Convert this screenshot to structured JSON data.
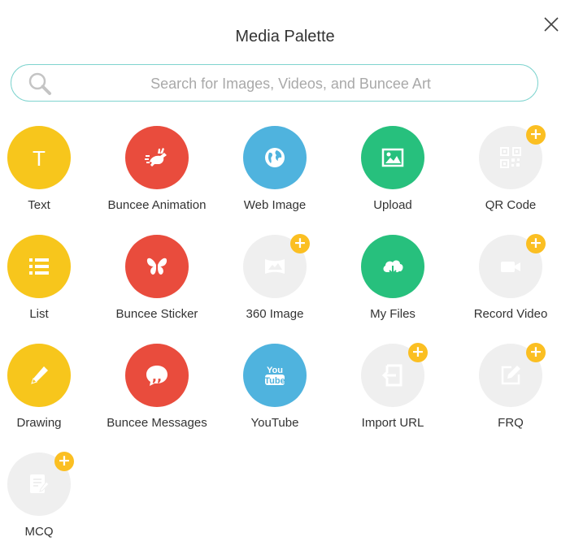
{
  "dialog": {
    "title": "Media Palette",
    "search_placeholder": "Search for Images, Videos, and Buncee Art"
  },
  "colors": {
    "yellow": "#f7c61c",
    "red": "#e94c3d",
    "blue": "#4fb3de",
    "green": "#27c07d",
    "disabled": "#efefef",
    "premium_badge": "#fbbf22",
    "search_border": "#7fd4cf"
  },
  "items": [
    {
      "label": "Text",
      "icon": "text-t-icon",
      "color": "yellow",
      "premium": false
    },
    {
      "label": "Buncee Animation",
      "icon": "running-rabbit-icon",
      "color": "red",
      "premium": false
    },
    {
      "label": "Web Image",
      "icon": "globe-icon",
      "color": "blue",
      "premium": false
    },
    {
      "label": "Upload",
      "icon": "image-upload-icon",
      "color": "green",
      "premium": false
    },
    {
      "label": "QR Code",
      "icon": "qr-code-icon",
      "color": "disabled",
      "premium": true
    },
    {
      "label": "List",
      "icon": "list-icon",
      "color": "yellow",
      "premium": false
    },
    {
      "label": "Buncee Sticker",
      "icon": "butterfly-icon",
      "color": "red",
      "premium": false
    },
    {
      "label": "360 Image",
      "icon": "panorama-icon",
      "color": "disabled",
      "premium": true
    },
    {
      "label": "My Files",
      "icon": "cloud-download-icon",
      "color": "green",
      "premium": false
    },
    {
      "label": "Record Video",
      "icon": "video-camera-icon",
      "color": "disabled",
      "premium": true
    },
    {
      "label": "Drawing",
      "icon": "pencil-icon",
      "color": "yellow",
      "premium": false
    },
    {
      "label": "Buncee Messages",
      "icon": "chat-quote-icon",
      "color": "red",
      "premium": false
    },
    {
      "label": "YouTube",
      "icon": "youtube-icon",
      "color": "blue",
      "premium": false
    },
    {
      "label": "Import URL",
      "icon": "import-url-icon",
      "color": "disabled",
      "premium": true
    },
    {
      "label": "FRQ",
      "icon": "edit-square-icon",
      "color": "disabled",
      "premium": true
    },
    {
      "label": "MCQ",
      "icon": "edit-document-icon",
      "color": "disabled",
      "premium": true
    }
  ],
  "premium_badge_symbol": "+"
}
